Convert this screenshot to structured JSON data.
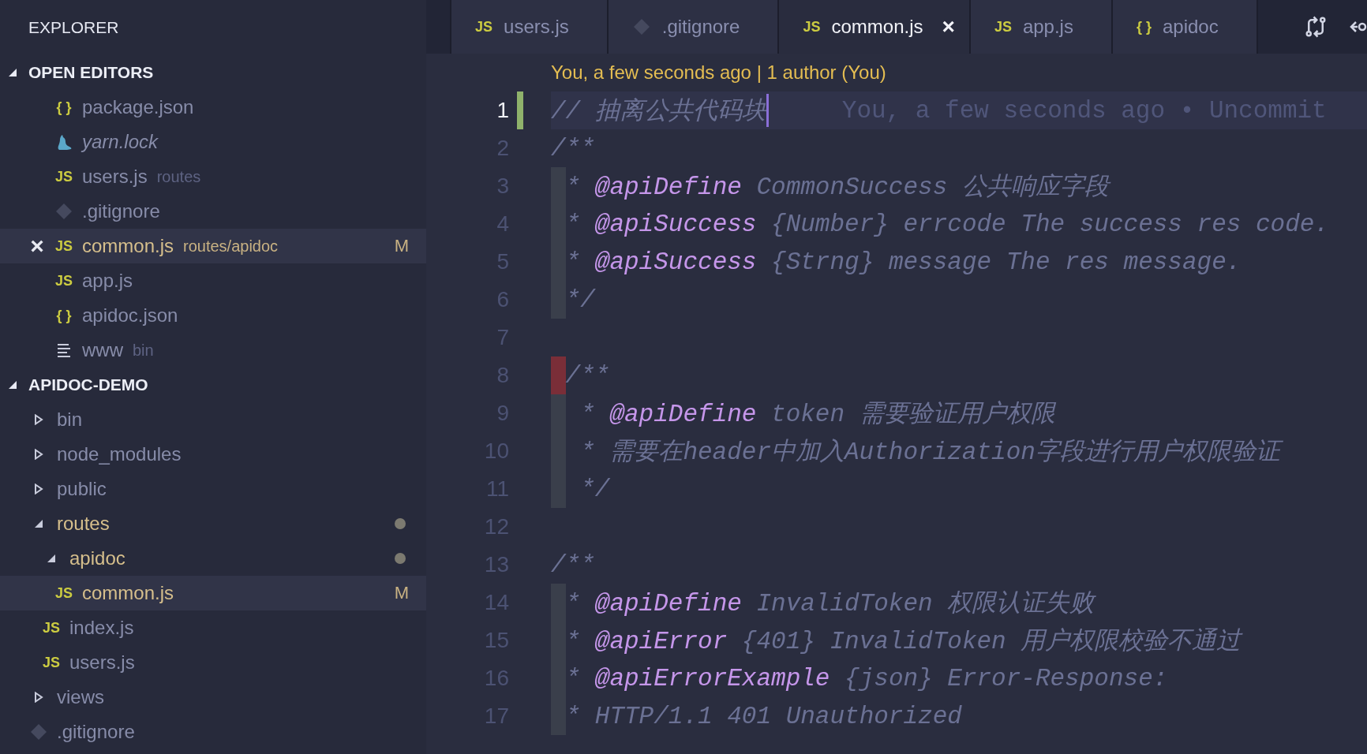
{
  "sidebar": {
    "title": "EXPLORER",
    "sections": [
      {
        "title": "OPEN EDITORS",
        "kind": "editors",
        "expanded": true,
        "items": [
          {
            "name": "package.json",
            "kind": "json",
            "icon_text": "{ }",
            "selected": false,
            "modified": false,
            "preview": false
          },
          {
            "name": "yarn.lock",
            "kind": "yarn",
            "selected": false,
            "modified": false,
            "preview": true
          },
          {
            "name": "users.js",
            "description": "routes",
            "kind": "js",
            "icon_text": "JS",
            "selected": false,
            "modified": false,
            "preview": false
          },
          {
            "name": ".gitignore",
            "kind": "git",
            "selected": false,
            "modified": false,
            "preview": false
          },
          {
            "name": "common.js",
            "description": "routes/apidoc",
            "kind": "js",
            "icon_text": "JS",
            "close": "×",
            "badge": "M",
            "selected": true,
            "modified": true,
            "preview": false
          },
          {
            "name": "app.js",
            "kind": "js",
            "icon_text": "JS",
            "selected": false,
            "modified": false,
            "preview": false
          },
          {
            "name": "apidoc.json",
            "kind": "json",
            "icon_text": "{ }",
            "selected": false,
            "modified": false,
            "preview": false
          },
          {
            "name": "www",
            "description": "bin",
            "kind": "lines",
            "selected": false,
            "modified": false,
            "preview": false
          }
        ]
      },
      {
        "title": "APIDOC-DEMO",
        "kind": "tree",
        "expanded": true,
        "items": [
          {
            "name": "bin",
            "kind": "folder",
            "expanded": false,
            "selected": false,
            "modified": false,
            "changed": false
          },
          {
            "name": "node_modules",
            "kind": "folder",
            "expanded": false,
            "selected": false,
            "modified": false,
            "changed": false
          },
          {
            "name": "public",
            "kind": "folder",
            "expanded": false,
            "selected": false,
            "modified": false,
            "changed": false
          },
          {
            "name": "routes",
            "kind": "folder",
            "expanded": true,
            "selected": false,
            "modified": true,
            "changed": true,
            "children": [
              {
                "name": "apidoc",
                "kind": "folder",
                "expanded": true,
                "selected": false,
                "modified": true,
                "changed": true,
                "children": [
                  {
                    "name": "common.js",
                    "kind": "js",
                    "icon_text": "JS",
                    "badge": "M",
                    "selected": true,
                    "modified": true,
                    "changed": false
                  }
                ]
              },
              {
                "name": "index.js",
                "kind": "js",
                "icon_text": "JS",
                "selected": false,
                "modified": false,
                "changed": false
              },
              {
                "name": "users.js",
                "kind": "js",
                "icon_text": "JS",
                "selected": false,
                "modified": false,
                "changed": false
              }
            ]
          },
          {
            "name": "views",
            "kind": "folder",
            "expanded": false,
            "selected": false,
            "modified": false,
            "changed": false
          },
          {
            "name": ".gitignore",
            "kind": "git",
            "selected": false,
            "modified": false,
            "changed": false
          }
        ]
      }
    ]
  },
  "tabs": [
    {
      "label": "users.js",
      "kind": "js",
      "icon_text": "JS",
      "selected": false
    },
    {
      "label": ".gitignore",
      "kind": "git",
      "selected": false
    },
    {
      "label": "common.js",
      "kind": "js",
      "icon_text": "JS",
      "close": "×",
      "selected": true
    },
    {
      "label": "app.js",
      "kind": "js",
      "icon_text": "JS",
      "selected": false
    },
    {
      "label": "apidoc",
      "kind": "json",
      "icon_text": "{ }",
      "selected": false
    }
  ],
  "editor": {
    "codelens": "You, a few seconds ago | 1 author (You)",
    "lines": [
      {
        "number": "1",
        "kind": "plain",
        "current": true,
        "changed": true,
        "tokens": [
          {
            "text": "// 抽离公共代码块",
            "kind": "comment"
          }
        ],
        "blame": "You, a few seconds ago • Uncommit"
      },
      {
        "number": "2",
        "kind": "plain",
        "current": false,
        "changed": false,
        "tokens": [
          {
            "text": "/**",
            "kind": "comment"
          }
        ]
      },
      {
        "number": "3",
        "kind": "indent",
        "current": false,
        "changed": false,
        "tokens": [
          {
            "text": "* ",
            "kind": "comment"
          },
          {
            "text": "@apiDefine",
            "kind": "tag"
          },
          {
            "text": " CommonSuccess 公共响应字段",
            "kind": "comment"
          }
        ]
      },
      {
        "number": "4",
        "kind": "indent",
        "current": false,
        "changed": false,
        "tokens": [
          {
            "text": "* ",
            "kind": "comment"
          },
          {
            "text": "@apiSuccess",
            "kind": "tag"
          },
          {
            "text": " {Number} errcode The success res code.",
            "kind": "comment"
          }
        ]
      },
      {
        "number": "5",
        "kind": "indent",
        "current": false,
        "changed": false,
        "tokens": [
          {
            "text": "* ",
            "kind": "comment"
          },
          {
            "text": "@apiSuccess",
            "kind": "tag"
          },
          {
            "text": " {Strng} message The res message.",
            "kind": "comment"
          }
        ]
      },
      {
        "number": "6",
        "kind": "indent",
        "current": false,
        "changed": false,
        "tokens": [
          {
            "text": "*/",
            "kind": "comment"
          }
        ]
      },
      {
        "number": "7",
        "kind": "plain",
        "current": false,
        "changed": false
      },
      {
        "number": "8",
        "kind": "error",
        "current": false,
        "changed": false,
        "tokens": [
          {
            "text": "/**",
            "kind": "comment"
          }
        ]
      },
      {
        "number": "9",
        "kind": "indent",
        "current": false,
        "changed": false,
        "tokens": [
          {
            "text": " * ",
            "kind": "comment"
          },
          {
            "text": "@apiDefine",
            "kind": "tag"
          },
          {
            "text": " token 需要验证用户权限",
            "kind": "comment"
          }
        ]
      },
      {
        "number": "10",
        "kind": "indent",
        "current": false,
        "changed": false,
        "tokens": [
          {
            "text": " * 需要在header中加入Authorization字段进行用户权限验证",
            "kind": "comment"
          }
        ]
      },
      {
        "number": "11",
        "kind": "indent",
        "current": false,
        "changed": false,
        "tokens": [
          {
            "text": " */",
            "kind": "comment"
          }
        ]
      },
      {
        "number": "12",
        "kind": "plain",
        "current": false,
        "changed": false
      },
      {
        "number": "13",
        "kind": "plain",
        "current": false,
        "changed": false,
        "tokens": [
          {
            "text": "/**",
            "kind": "comment"
          }
        ]
      },
      {
        "number": "14",
        "kind": "indent",
        "current": false,
        "changed": false,
        "tokens": [
          {
            "text": "* ",
            "kind": "comment"
          },
          {
            "text": "@apiDefine",
            "kind": "tag"
          },
          {
            "text": " InvalidToken 权限认证失败",
            "kind": "comment"
          }
        ]
      },
      {
        "number": "15",
        "kind": "indent",
        "current": false,
        "changed": false,
        "tokens": [
          {
            "text": "* ",
            "kind": "comment"
          },
          {
            "text": "@apiError",
            "kind": "tag"
          },
          {
            "text": " {401} InvalidToken 用户权限校验不通过",
            "kind": "comment"
          }
        ]
      },
      {
        "number": "16",
        "kind": "indent",
        "current": false,
        "changed": false,
        "tokens": [
          {
            "text": "* ",
            "kind": "comment"
          },
          {
            "text": "@apiErrorExample",
            "kind": "tag"
          },
          {
            "text": " {json} Error-Response:",
            "kind": "comment"
          }
        ]
      },
      {
        "number": "17",
        "kind": "indent",
        "current": false,
        "changed": false,
        "tokens": [
          {
            "text": "* HTTP/1.1 401 Unauthorized",
            "kind": "comment"
          }
        ]
      }
    ]
  }
}
